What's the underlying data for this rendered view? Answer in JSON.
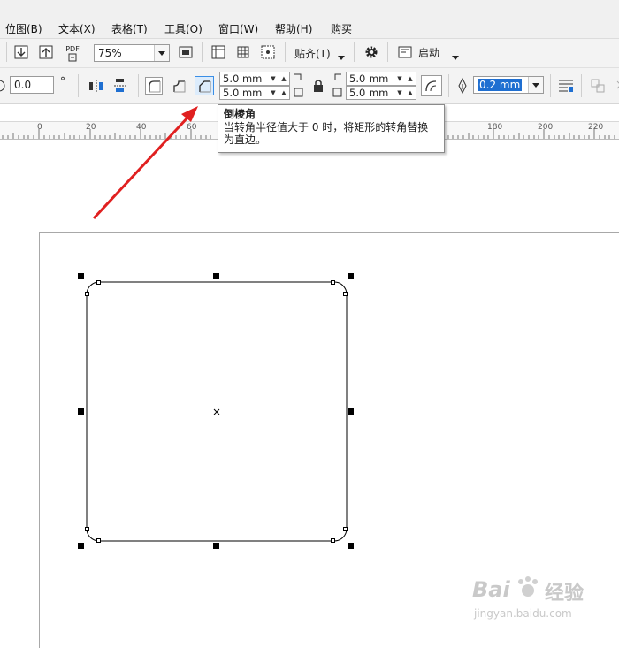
{
  "menu": {
    "items": [
      "位图(B)",
      "文本(X)",
      "表格(T)",
      "工具(O)",
      "窗口(W)",
      "帮助(H)",
      "购买"
    ]
  },
  "toolbar1": {
    "zoom": "75%",
    "pdf_label": "PDF",
    "snap_label": "贴齐(T)",
    "launch_label": "启动"
  },
  "toolbar2": {
    "angle_value": "0.0",
    "angle_unit": "°",
    "corner_left_top": "5.0 mm",
    "corner_left_bottom": "5.0 mm",
    "corner_right_top": "5.0 mm",
    "corner_right_bottom": "5.0 mm",
    "outline_width": "0.2 mm"
  },
  "ruler": {
    "labels": [
      "0",
      "20",
      "40",
      "60",
      "180",
      "200",
      "220"
    ]
  },
  "tooltip": {
    "title": "倒棱角",
    "line1": "当转角半径值大于 0 时，将矩形的转角替换",
    "line2": "为直边。"
  },
  "watermark": {
    "brand": "Bai",
    "brand2": "经验",
    "url": "jingyan.baidu.com"
  },
  "colors": {
    "arrow": "#e02020",
    "selection": "#1f6fd1",
    "toolbar_bg": "#f3f3f3"
  }
}
